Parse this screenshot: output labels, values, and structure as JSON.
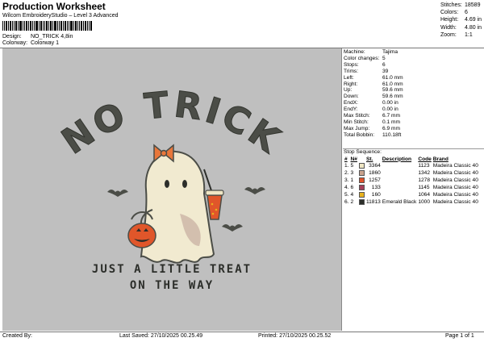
{
  "header": {
    "title": "Production Worksheet",
    "subtitle": "Wilcom EmbroideryStudio – Level 3 Advanced",
    "design_label": "Design:",
    "design_value": "NO_TRICK 4,8in",
    "colorway_label": "Colorway:",
    "colorway_value": "Colorway 1"
  },
  "stats": [
    {
      "k": "Stitches:",
      "v": "18589"
    },
    {
      "k": "Colors:",
      "v": "6"
    },
    {
      "k": "Height:",
      "v": "4.69 in"
    },
    {
      "k": "Width:",
      "v": "4.80 in"
    },
    {
      "k": "Zoom:",
      "v": "1:1"
    }
  ],
  "info": [
    {
      "k": "Machine:",
      "v": "Tajima"
    },
    {
      "k": "Color changes:",
      "v": "5"
    },
    {
      "k": "Stops:",
      "v": "6"
    },
    {
      "k": "Trims:",
      "v": "39"
    },
    {
      "k": "Left:",
      "v": "61.0 mm"
    },
    {
      "k": "Right:",
      "v": "61.0 mm"
    },
    {
      "k": "Up:",
      "v": "59.6 mm"
    },
    {
      "k": "Down:",
      "v": "59.6 mm"
    },
    {
      "k": "EndX:",
      "v": "0.00 in"
    },
    {
      "k": "EndY:",
      "v": "0.00 in"
    },
    {
      "k": "Max Stitch:",
      "v": "6.7 mm"
    },
    {
      "k": "Min Stitch:",
      "v": "0.1 mm"
    },
    {
      "k": "Max Jump:",
      "v": "6.9 mm"
    },
    {
      "k": "Total Bobbin:",
      "v": "110.18ft"
    }
  ],
  "stop_sequence": {
    "title": "Stop Sequence:",
    "headers": [
      "#",
      "N#",
      "St.",
      "Description",
      "Code",
      "Brand"
    ],
    "rows": [
      {
        "n": "1.",
        "needle": "5",
        "color": "#efe6c4",
        "st": "3364",
        "desc": "",
        "code": "1123",
        "brand": "Madeira Classic 40"
      },
      {
        "n": "2.",
        "needle": "3",
        "color": "#c9a38e",
        "st": "1860",
        "desc": "",
        "code": "1342",
        "brand": "Madeira Classic 40"
      },
      {
        "n": "3.",
        "needle": "1",
        "color": "#e0522a",
        "st": "1257",
        "desc": "",
        "code": "1278",
        "brand": "Madeira Classic 40"
      },
      {
        "n": "4.",
        "needle": "6",
        "color": "#a5405a",
        "st": "133",
        "desc": "",
        "code": "1145",
        "brand": "Madeira Classic 40"
      },
      {
        "n": "5.",
        "needle": "4",
        "color": "#e7b21e",
        "st": "160",
        "desc": "",
        "code": "1064",
        "brand": "Madeira Classic 40"
      },
      {
        "n": "6.",
        "needle": "2",
        "color": "#2c2e2a",
        "st": "11813",
        "desc": "Emerald Black",
        "code": "1000",
        "brand": "Madeira Classic 40"
      }
    ]
  },
  "design": {
    "headline": "NO TRICK",
    "line1": "JUST A LITTLE TREAT",
    "line2": "ON THE WAY",
    "colors": {
      "background": "#bfbfbf",
      "dark": "#4b4d47",
      "ghost": "#f1ead0",
      "shadow": "#d3bfae",
      "pumpkin": "#e0562a",
      "bow": "#e9773a",
      "cup": "#e7b21e"
    }
  },
  "footer": {
    "created_by": "Created By:",
    "last_saved": "Last Saved: 27/10/2025 00.25.49",
    "printed": "Printed: 27/10/2025 00.25.52",
    "page": "Page 1 of 1"
  }
}
